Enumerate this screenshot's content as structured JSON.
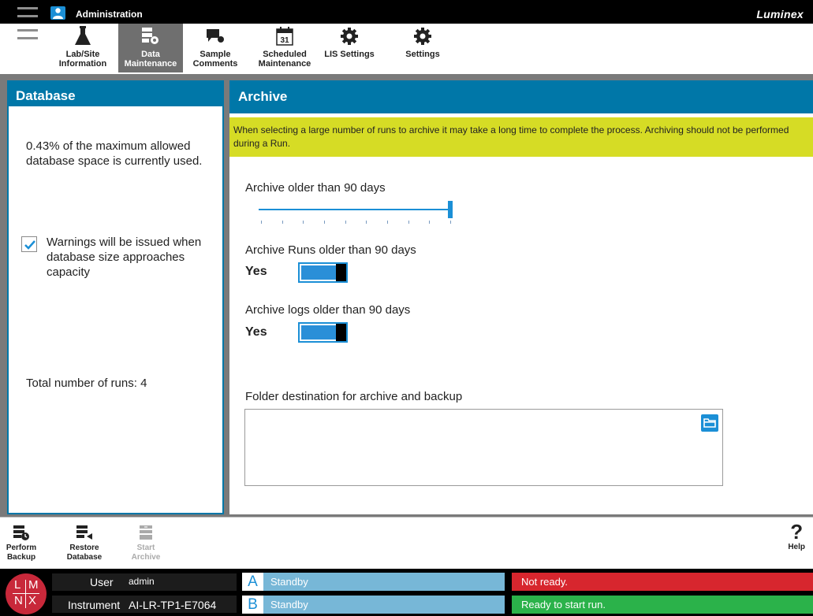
{
  "window": {
    "app_title": "Administration",
    "brand": "Luminex"
  },
  "toolbar": {
    "items": [
      {
        "label": "Lab/Site\nInformation",
        "icon": "flask-icon",
        "active": false
      },
      {
        "label": "Data\nMaintenance",
        "icon": "database-gear-icon",
        "active": true
      },
      {
        "label": "Sample\nComments",
        "icon": "comment-icon",
        "active": false
      },
      {
        "label": "Scheduled\nMaintenance",
        "icon": "calendar-icon",
        "active": false
      },
      {
        "label": "LIS Settings",
        "icon": "gear-icon",
        "active": false
      },
      {
        "label": "Settings",
        "icon": "gear-icon",
        "active": false
      }
    ],
    "calendar_day": "31"
  },
  "database": {
    "title": "Database",
    "usage_text": "0.43% of the maximum allowed database space is currently used.",
    "warnings_checked": true,
    "warnings_text": "Warnings will be issued when database size approaches capacity",
    "runs_text": "Total number of runs: 4"
  },
  "archive": {
    "title": "Archive",
    "warning": "When selecting a large number of runs to archive it may take a long time to complete the process. Archiving should not be performed during a Run.",
    "older_label": "Archive older than 90 days",
    "slider_fraction": 1.0,
    "runs_label": "Archive Runs older than 90 days",
    "runs_value": "Yes",
    "runs_on": true,
    "logs_label": "Archive logs older than 90 days",
    "logs_value": "Yes",
    "logs_on": true,
    "folder_label": "Folder destination for archive and backup",
    "folder_value": ""
  },
  "actions": [
    {
      "label": "Perform\nBackup",
      "icon": "backup-icon",
      "enabled": true
    },
    {
      "label": "Restore\nDatabase",
      "icon": "restore-icon",
      "enabled": true
    },
    {
      "label": "Start\nArchive",
      "icon": "archive-icon",
      "enabled": false
    }
  ],
  "help": {
    "label": "Help",
    "glyph": "?"
  },
  "status": {
    "logo_letters": [
      "L",
      "M",
      "N",
      "X"
    ],
    "user_label": "User",
    "user_value": "admin",
    "instrument_label": "Instrument",
    "instrument_value": "AI-LR-TP1-E7064",
    "bays": [
      {
        "letter": "A",
        "status": "Standby"
      },
      {
        "letter": "B",
        "status": "Standby"
      }
    ],
    "states": [
      {
        "text": "Not ready.",
        "color": "#d7262e"
      },
      {
        "text": "Ready to start run.",
        "color": "#2bb24a"
      }
    ]
  },
  "colors": {
    "accent": "#0077a8",
    "banner": "#d6dc25",
    "control": "#1b8fd6"
  }
}
